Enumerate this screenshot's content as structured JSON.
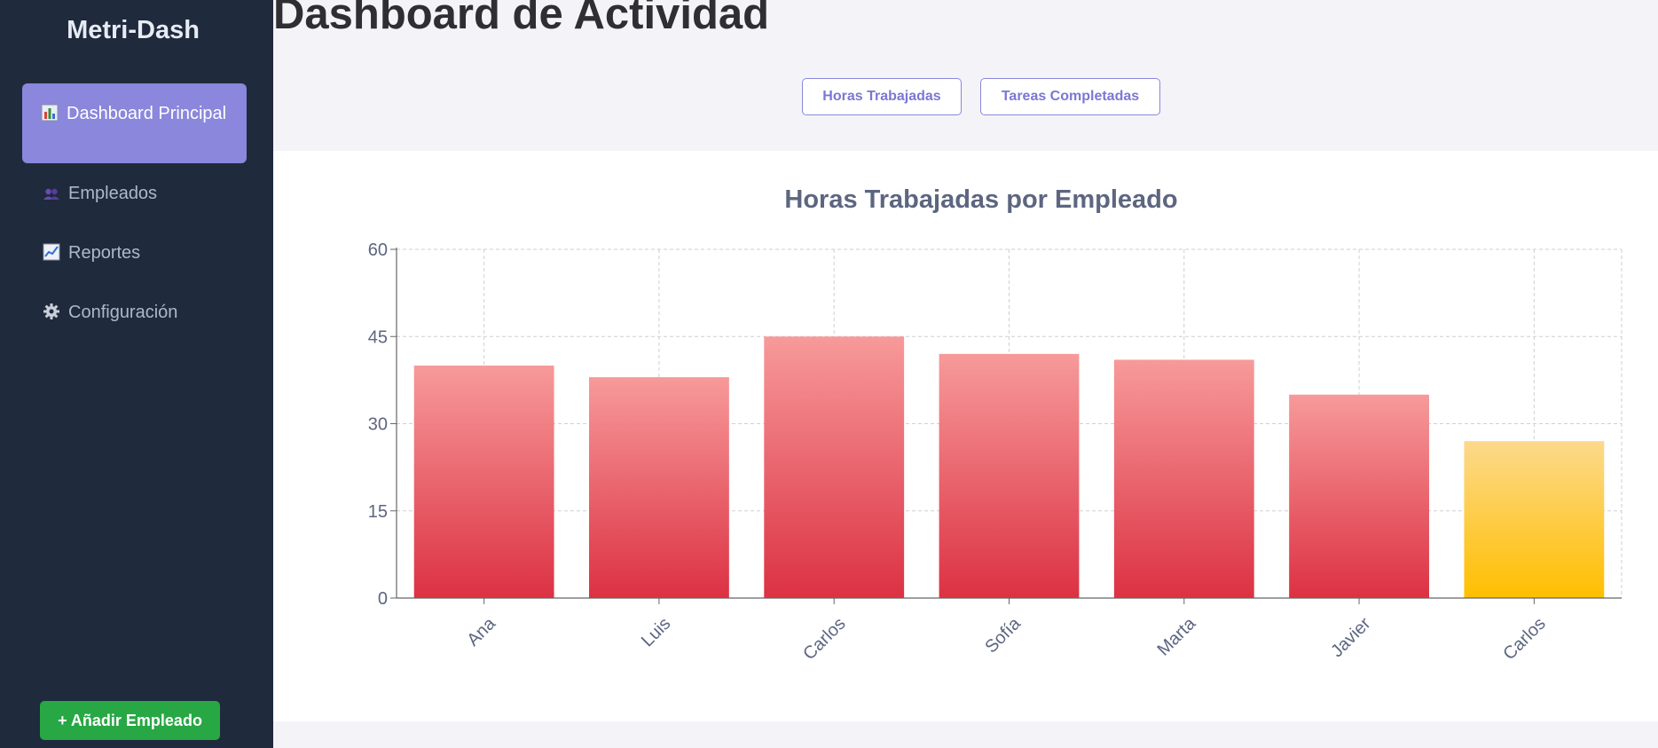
{
  "sidebar": {
    "brand": "Metri-Dash",
    "items": [
      {
        "label": "Dashboard Principal",
        "icon": "bar-chart-icon"
      },
      {
        "label": "Empleados",
        "icon": "users-icon"
      },
      {
        "label": "Reportes",
        "icon": "trend-chart-icon"
      },
      {
        "label": "Configuración",
        "icon": "gear-icon"
      }
    ],
    "add_button": "+ Añadir Empleado"
  },
  "main": {
    "title": "Dashboard de Actividad",
    "toggles": [
      "Horas Trabajadas",
      "Tareas Completadas"
    ]
  },
  "colors": {
    "accent": "#8a87dc",
    "bar_red_top": "#f79a9a",
    "bar_red_bottom": "#dc3143",
    "bar_yellow_top": "#fcd98c",
    "bar_yellow_bottom": "#ffbf00",
    "add_button": "#28a745"
  },
  "chart_data": {
    "type": "bar",
    "title": "Horas Trabajadas por Empleado",
    "categories": [
      "Ana",
      "Luis",
      "Carlos",
      "Sofía",
      "Marta",
      "Javier",
      "Carlos"
    ],
    "values": [
      40,
      38,
      45,
      42,
      41,
      35,
      27
    ],
    "highlight_index": 6,
    "ylim": [
      0,
      60
    ],
    "yticks": [
      0,
      15,
      30,
      45,
      60
    ],
    "grid": true,
    "xlabel": "",
    "ylabel": ""
  }
}
